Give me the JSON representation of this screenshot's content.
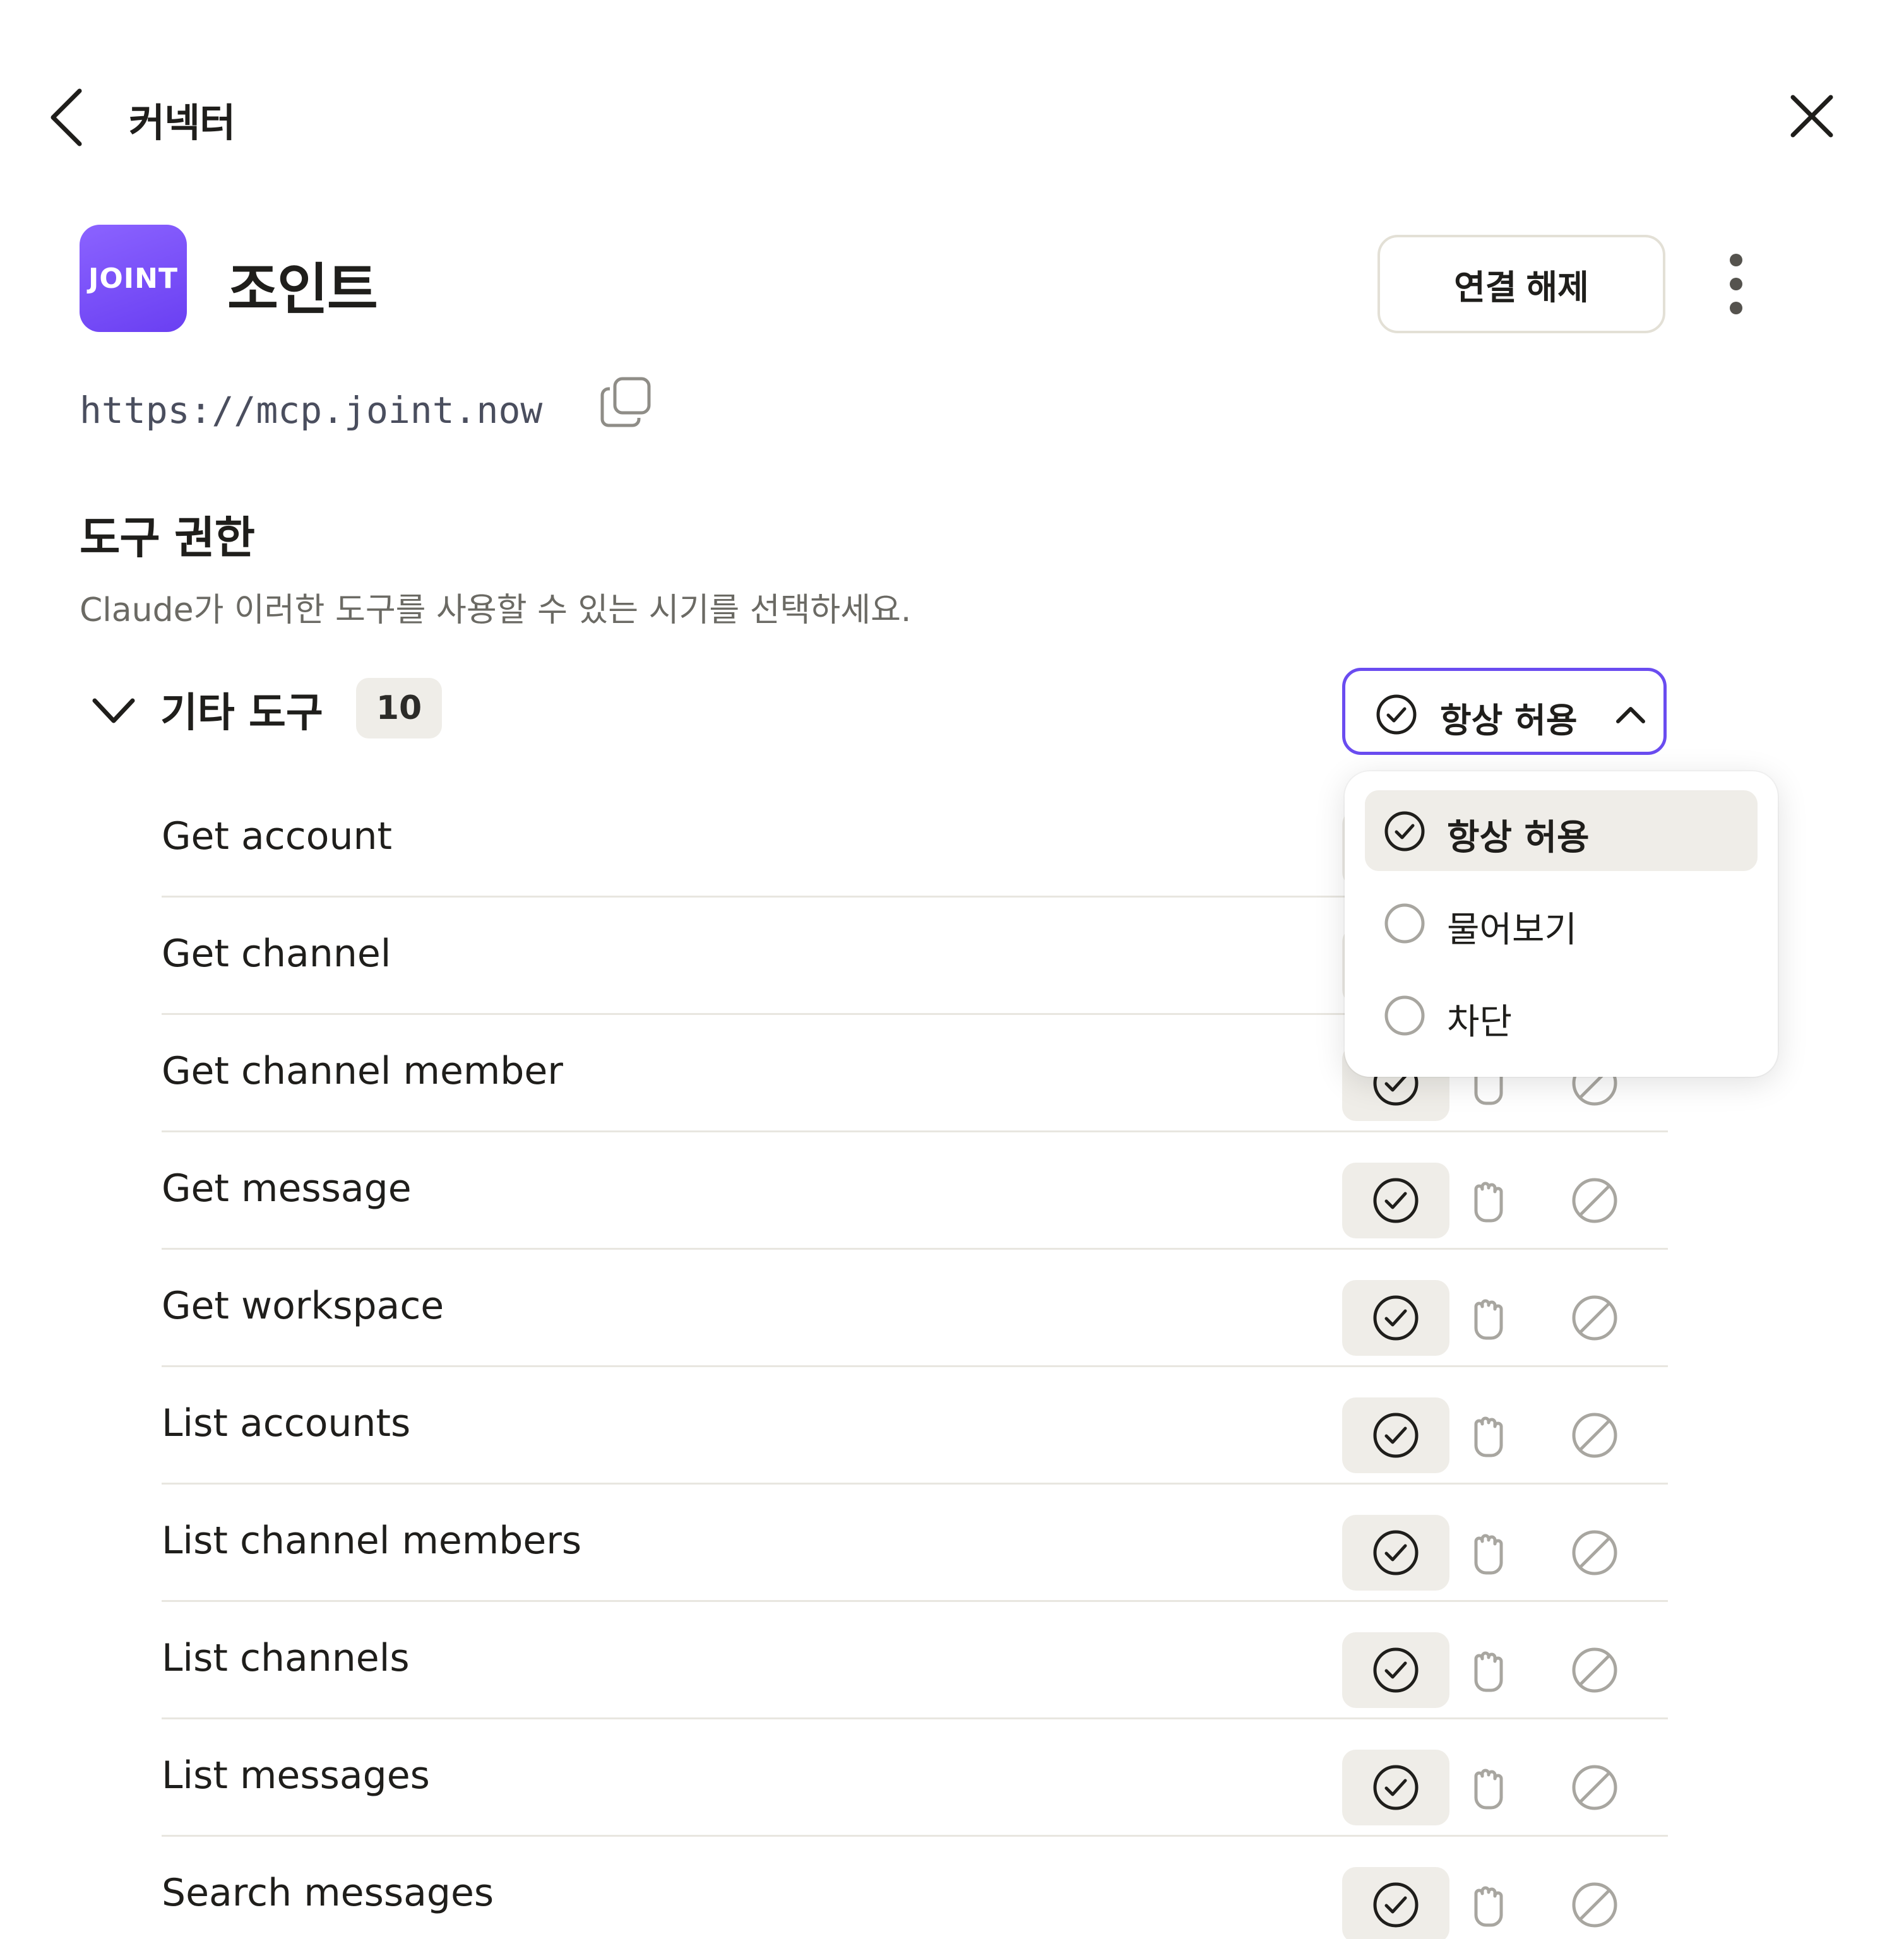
{
  "header": {
    "title": "커넥터"
  },
  "app": {
    "logo_text": "JOINT",
    "name": "조인트",
    "disconnect_label": "연결 해제",
    "url": "https://mcp.joint.now"
  },
  "permissions": {
    "title": "도구 권한",
    "description": "Claude가 이러한 도구를 사용할 수 있는 시기를 선택하세요."
  },
  "group": {
    "title": "기타 도구",
    "count": "10",
    "dropdown_value": "항상 허용"
  },
  "menu": {
    "options": [
      {
        "label": "항상 허용",
        "selected": true
      },
      {
        "label": "물어보기",
        "selected": false
      },
      {
        "label": "차단",
        "selected": false
      }
    ]
  },
  "tools": [
    {
      "name": "Get account",
      "permission": "allow"
    },
    {
      "name": "Get channel",
      "permission": "allow"
    },
    {
      "name": "Get channel member",
      "permission": "allow"
    },
    {
      "name": "Get message",
      "permission": "allow"
    },
    {
      "name": "Get workspace",
      "permission": "allow"
    },
    {
      "name": "List accounts",
      "permission": "allow"
    },
    {
      "name": "List channel members",
      "permission": "allow"
    },
    {
      "name": "List channels",
      "permission": "allow"
    },
    {
      "name": "List messages",
      "permission": "allow"
    },
    {
      "name": "Search messages",
      "permission": "allow"
    }
  ],
  "colors": {
    "accent": "#6a4cf0",
    "logo": "#7b52fa",
    "selected_bg": "#efede8",
    "muted_icon": "#a8a6a0"
  }
}
